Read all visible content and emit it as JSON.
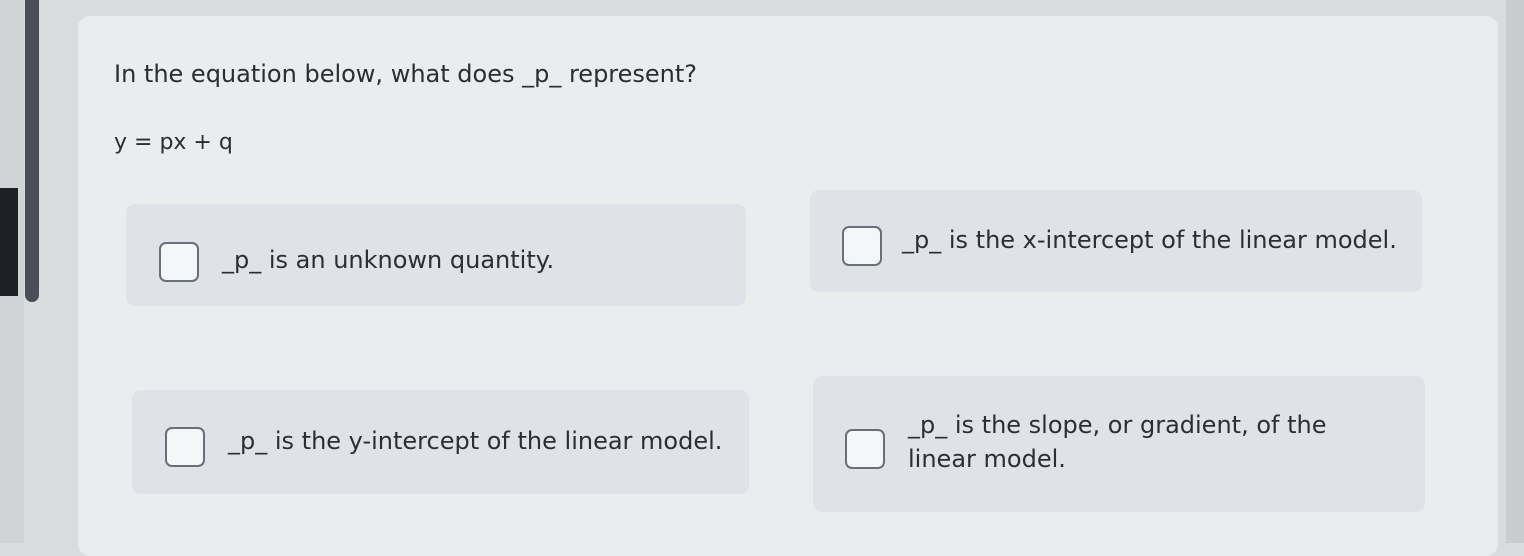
{
  "question": {
    "prompt": "In the equation below, what does _p_ represent?",
    "equation": "y = px + q"
  },
  "options": [
    {
      "label": "_p_ is an unknown quantity.",
      "checked": false
    },
    {
      "label": "_p_ is the x-intercept of the linear model.",
      "checked": false
    },
    {
      "label": "_p_ is the y-intercept of the linear model.",
      "checked": false
    },
    {
      "label": "_p_ is the slope, or gradient, of the linear model.",
      "checked": false
    }
  ]
}
